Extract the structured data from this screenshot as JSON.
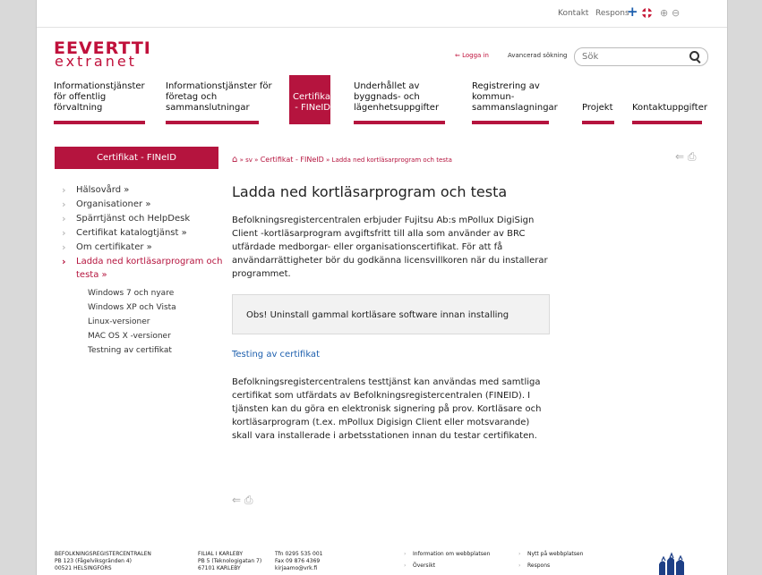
{
  "topbar": {
    "kontakt": "Kontakt",
    "respons": "Respons",
    "plus_icon": "plus-icon",
    "flag_icon": "uk-flag-icon",
    "zoom_icons": "zoom-icons"
  },
  "logo": {
    "line1": "EEVERTTI",
    "line2": "extranet"
  },
  "header": {
    "login": "Logga in",
    "advanced_search": "Avancerad sökning",
    "search_placeholder": "Sök"
  },
  "nav": [
    {
      "label": "Informationstjänster för offentlig förvaltning",
      "active": false
    },
    {
      "label": "Informationstjänster för företag och sammanslutningar",
      "active": false
    },
    {
      "label": "Certifikat - FINeID",
      "active": true
    },
    {
      "label": "Underhållet av byggnads- och lägenhetsuppgifter",
      "active": false
    },
    {
      "label": "Registrering av kommun-sammanslagningar",
      "active": false
    },
    {
      "label": "Projekt",
      "active": false
    },
    {
      "label": "Kontaktuppgifter",
      "active": false
    }
  ],
  "sidebar": {
    "heading": "Certifikat - FINeID",
    "items": [
      {
        "label": "Hälsovård »"
      },
      {
        "label": "Organisationer »"
      },
      {
        "label": "Spärrtjänst och HelpDesk"
      },
      {
        "label": "Certifikat katalogtjänst »"
      },
      {
        "label": "Om certifikater »"
      },
      {
        "label": "Ladda ned kortläsarprogram och testa »"
      }
    ],
    "subitems": [
      {
        "label": "Windows 7 och nyare"
      },
      {
        "label": "Windows XP och Vista"
      },
      {
        "label": "Linux-versioner"
      },
      {
        "label": "MAC OS X -versioner"
      },
      {
        "label": "Testning av certifikat"
      }
    ]
  },
  "breadcrumb": {
    "sep1": "»",
    "sv": "sv",
    "sep2": "»",
    "cert": "Certifikat - FINeID",
    "sep3": "»",
    "current": "Ladda ned kortläsarprogram och testa"
  },
  "main": {
    "title": "Ladda ned kortläsarprogram och testa",
    "intro": "Befolkningsregistercentralen erbjuder Fujitsu Ab:s mPollux DigiSign Client -kortläsarprogram avgiftsfritt till alla som använder av BRC utfärdade medborgar- eller organisationscertifikat. För att få användarrättigheter bör du godkänna licensvillkoren när du installerar programmet.",
    "notice": "Obs! Uninstall gammal kortläsare software innan installing",
    "test_link": "Testing av certifikat",
    "body": "Befolkningsregistercentralens testtjänst kan användas med samtliga certifikat som utfärdats av Befolkningsregistercentralen (FINEID). I tjänsten kan du göra en elektronisk signering på prov. Kortläsare och kortläsarprogram (t.ex. mPollux Digisign Client eller motsvarande) skall vara installerade i arbetsstationen innan du testar certifikaten."
  },
  "footer": {
    "col1": [
      "BEFOLKNINGSREGISTERCENTRALEN",
      "PB 123 (Fågelviksgränden 4)",
      "00521 HELSINGFORS"
    ],
    "col2": [
      "FILIAL I KARLEBY",
      "PB 5 (Teknologigatan 7)",
      "67101 KARLEBY"
    ],
    "col3": [
      "Tfn 0295 535 001",
      "Fax 09 876 4369",
      "kirjaamo@vrk.fi"
    ],
    "links": [
      "Information om webbplatsen",
      "Översikt",
      "Nytt på webbplatsen",
      "Respons"
    ]
  },
  "colors": {
    "brand": "#b5143e",
    "link": "#1d5fae"
  }
}
